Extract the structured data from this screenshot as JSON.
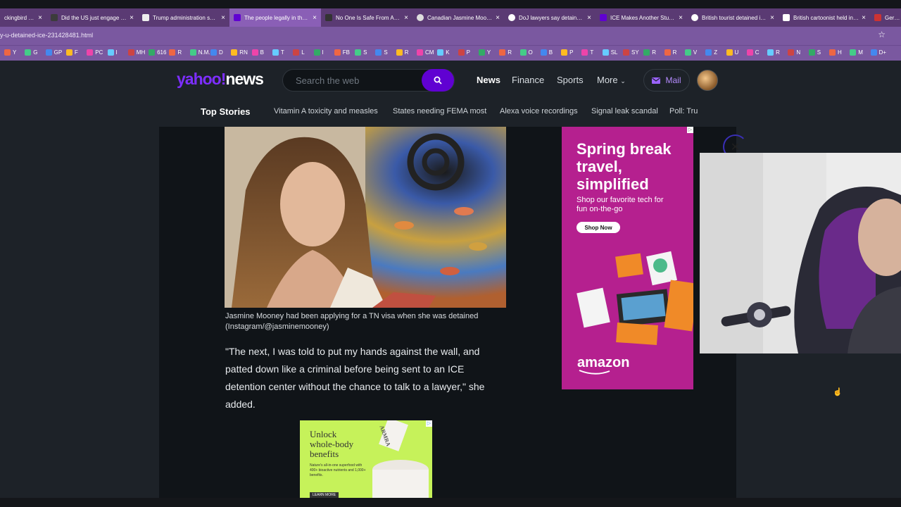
{
  "colors": {
    "accent": "#6001d2",
    "tab_active": "#8a5fb6",
    "ad_pink": "#b5208f",
    "ad_green": "#c6f25a"
  },
  "tabs": [
    {
      "title": "ckingbird ri...",
      "close": "×"
    },
    {
      "title": "Did the US just engage in...",
      "close": "×"
    },
    {
      "title": "Trump administration sen...",
      "close": "×"
    },
    {
      "title": "The people legally in the ...",
      "close": "×"
    },
    {
      "title": "No One Is Safe From Am...",
      "close": "×"
    },
    {
      "title": "Canadian Jasmine Moone...",
      "close": "×"
    },
    {
      "title": "DoJ lawyers say detained...",
      "close": "×"
    },
    {
      "title": "ICE Makes Another Stude...",
      "close": "×"
    },
    {
      "title": "British tourist detained in...",
      "close": "×"
    },
    {
      "title": "British cartoonist held in ...",
      "close": "×"
    },
    {
      "title": "German",
      "close": ""
    }
  ],
  "url": "y-u-detained-ice-231428481.html",
  "bookmarks": [
    "Y",
    "G",
    "GP",
    "F",
    "PC",
    "I",
    "MH",
    "616",
    "R",
    "N.M.",
    "D",
    "RN",
    "B",
    "T",
    "L",
    "I",
    "FB",
    "S",
    "S",
    "R",
    "CM",
    "K",
    "P",
    "Y",
    "R",
    "O",
    "B",
    "P",
    "T",
    "SL",
    "SY",
    "R",
    "R",
    "V",
    "Z",
    "U",
    "C",
    "R",
    "N",
    "S",
    "H",
    "M",
    "D+"
  ],
  "header": {
    "logo_yahoo": "yahoo!",
    "logo_news": "news",
    "search_placeholder": "Search the web",
    "nav": [
      "News",
      "Finance",
      "Sports",
      "More"
    ],
    "mail": "Mail"
  },
  "subnav": {
    "title": "Top Stories",
    "items": [
      "Vitamin A toxicity and measles",
      "States needing FEMA most",
      "Alexa voice recordings",
      "Signal leak scandal",
      "Poll: Tru"
    ]
  },
  "article": {
    "caption": "Jasmine Mooney had been applying for a TN visa when she was detained (Instagram/@jasminemooney)",
    "quote": "\"The next, I was told to put my hands against the wall, and patted down like a criminal before being sent to an ICE detention center without the chance to talk to a lawyer,\" she added."
  },
  "ad_amazon": {
    "headline": "Spring break travel, simplified",
    "body": "Shop our favorite tech for fun on-the-go",
    "cta": "Shop Now",
    "brand": "amazon"
  },
  "ad_armra": {
    "headline": "Unlock whole-body benefits",
    "body": "Nature's all-in-one superfood with 400+ bioactive nutrients and 1,000+ benefits.",
    "cta": "LEARN MORE",
    "brand": "ARMRA"
  }
}
